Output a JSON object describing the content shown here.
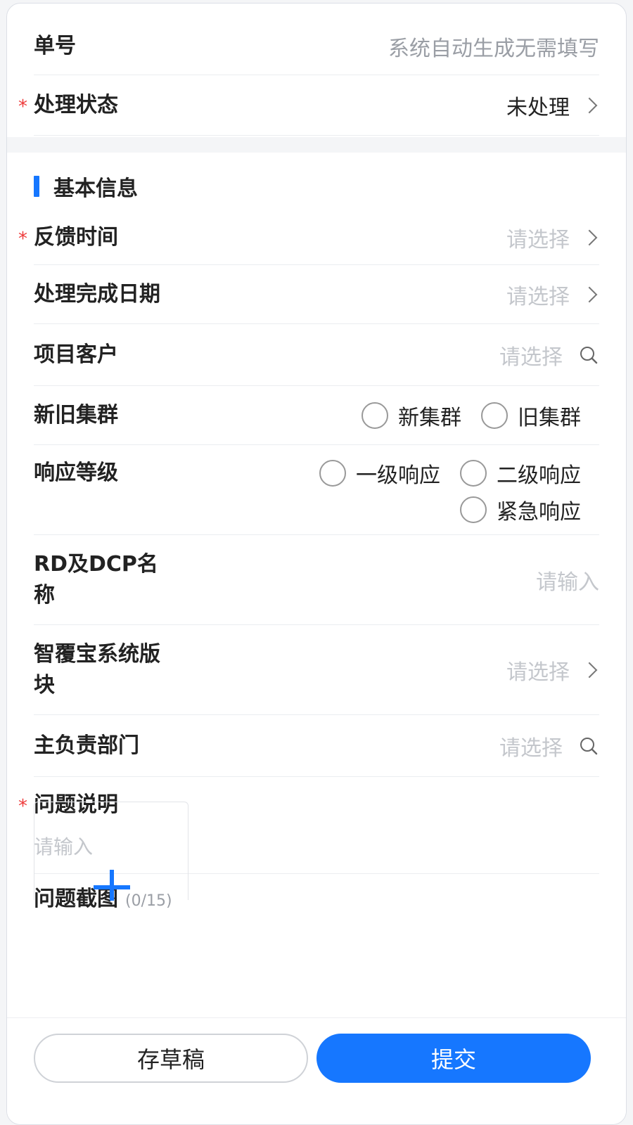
{
  "header_card": {
    "order_no": {
      "label": "单号",
      "value": "系统自动生成无需填写"
    },
    "status": {
      "label": "处理状态",
      "value": "未处理"
    }
  },
  "basic_info": {
    "section_title": "基本信息",
    "feedback_time": {
      "label": "反馈时间",
      "placeholder": "请选择"
    },
    "complete_date": {
      "label": "处理完成日期",
      "placeholder": "请选择"
    },
    "project_customer": {
      "label": "项目客户",
      "placeholder": "请选择"
    },
    "cluster": {
      "label": "新旧集群",
      "options": [
        "新集群",
        "旧集群"
      ]
    },
    "response_level": {
      "label": "响应等级",
      "options": [
        "一级响应",
        "二级响应",
        "紧急响应"
      ]
    },
    "rd_dcp_name": {
      "label_line1": "RD及DCP名",
      "label_line2": "称",
      "placeholder": "请输入"
    },
    "system_module": {
      "label_line1": "智覆宝系统版",
      "label_line2": "块",
      "placeholder": "请选择"
    },
    "main_department": {
      "label": "主负责部门",
      "placeholder": "请选择"
    },
    "problem_desc": {
      "label": "问题说明",
      "placeholder": "请输入"
    },
    "screenshots": {
      "label": "问题截图",
      "count": "(0/15)"
    }
  },
  "footer": {
    "draft_label": "存草稿",
    "submit_label": "提交"
  },
  "colors": {
    "accent": "#1677ff",
    "required": "#ee3b3b",
    "placeholder": "#c4c7cc"
  }
}
